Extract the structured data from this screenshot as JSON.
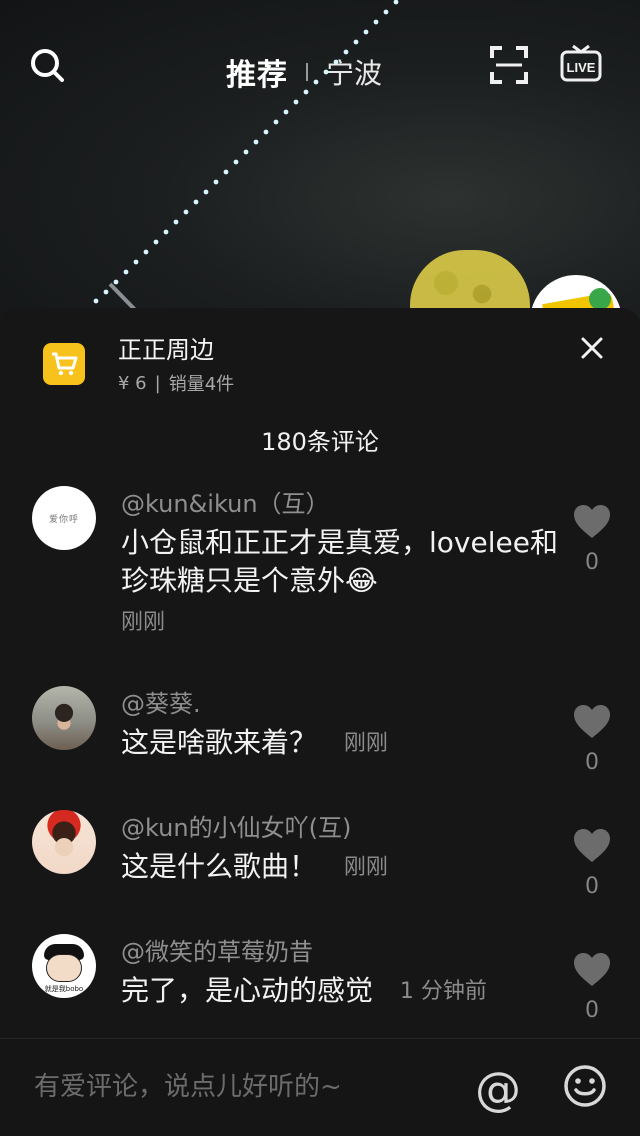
{
  "top_nav": {
    "search_icon": "search-icon",
    "tabs": [
      {
        "label": "推荐",
        "active": true
      },
      {
        "label": "宁波",
        "active": false
      }
    ],
    "scan_icon": "scan-icon",
    "live_icon": "live-icon",
    "live_label": "LIVE"
  },
  "product": {
    "name": "正正周边",
    "price": "¥ 6",
    "separator": "|",
    "sales": "销量4件",
    "icon": "cart-icon"
  },
  "comments": {
    "header": "180条评论",
    "items": [
      {
        "user": "@kun&ikun（互）",
        "text": "小仓鼠和正正才是真爱，lovelee和珍珠糖只是个意外😂",
        "time": "刚刚",
        "likes": "0",
        "avatar_text": "爱你呼"
      },
      {
        "user": "@葵葵.",
        "text": "这是啥歌来着？",
        "time": "刚刚",
        "likes": "0"
      },
      {
        "user": "@kun的小仙女吖(互)",
        "text": "这是什么歌曲！",
        "time": "刚刚",
        "likes": "0"
      },
      {
        "user": "@微笑的草莓奶昔",
        "text": "完了，是心动的感觉",
        "time": "1 分钟前",
        "likes": "0",
        "avatar_text": "就是我bobo"
      }
    ]
  },
  "input": {
    "placeholder": "有爱评论，说点儿好听的~",
    "at_symbol": "@",
    "emoji_icon": "smile-icon"
  },
  "colors": {
    "panel_bg": "#161616",
    "cart_yellow": "#f7c21b",
    "muted_text": "#8b8b8b"
  }
}
